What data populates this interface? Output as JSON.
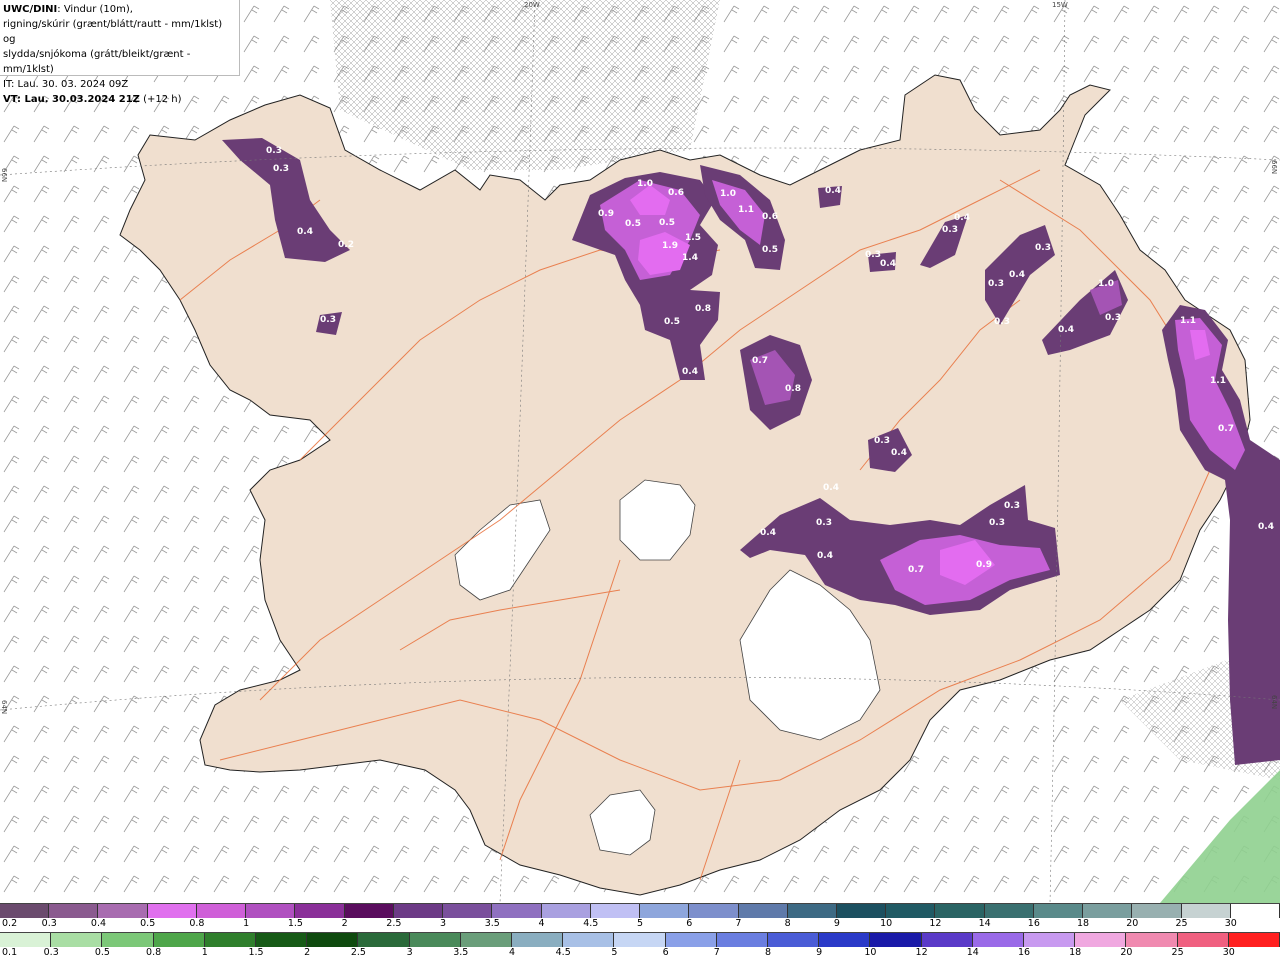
{
  "header": {
    "model": "UWC/DINI",
    "desc_line1": ": Vindur (10m),",
    "desc_line2": "rigning/skúrir (grænt/blátt/rautt - mm/1klst) og",
    "desc_line3": "slydda/snjókoma (grátt/bleikt/grænt - mm/1klst)",
    "it_line": "IT: Lau. 30. 03. 2024 09Z",
    "vt_label": "VT: Lau. 30.03.2024 21Z",
    "vt_suffix": " (+12 h)"
  },
  "grid_labels": [
    "20W",
    "15W",
    "66N",
    "66N",
    "64N",
    "64N"
  ],
  "map_values": [
    "0.3",
    "0.3",
    "0.4",
    "0.2",
    "0.3",
    "0.9",
    "1.0",
    "0.6",
    "0.5",
    "0.5",
    "1.9",
    "1.5",
    "1.4",
    "0.8",
    "0.5",
    "0.4",
    "1.0",
    "1.1",
    "0.6",
    "0.5",
    "0.4",
    "0.7",
    "0.8",
    "0.4",
    "0.3",
    "0.3",
    "0.4",
    "0.3",
    "0.4",
    "0.3",
    "0.3",
    "0.3",
    "1.0",
    "0.4",
    "0.3",
    "0.4",
    "0.4",
    "0.3",
    "0.4",
    "0.4",
    "0.7",
    "0.9",
    "0.3",
    "0.3",
    "1.1",
    "1.1",
    "0.7",
    "0.4"
  ],
  "colors": {
    "land": "#f0dfcf",
    "roads": "#e8703a",
    "sea": "#ffffff",
    "snow_light": "#9b5fa8",
    "snow_dark": "#6a3d75",
    "snow_bright": "#e36cf0",
    "rain_green": "#8fd08f"
  },
  "legend_top": {
    "labels": [
      "0.2",
      "0.3",
      "0.4",
      "0.5",
      "0.8",
      "1",
      "1.5",
      "2",
      "2.5",
      "3",
      "3.5",
      "4",
      "4.5",
      "5",
      "6",
      "7",
      "8",
      "9",
      "10",
      "12",
      "14",
      "16",
      "18",
      "20",
      "25",
      "30"
    ],
    "colors": [
      "#6b4b6e",
      "#8a5a8f",
      "#a86cb0",
      "#e070ee",
      "#cf5fd8",
      "#b050c0",
      "#8a2f99",
      "#5a0d5e",
      "#6c3a86",
      "#7a4f9c",
      "#8f70c0",
      "#a9a0e0",
      "#c0c0f4",
      "#8ea6dc",
      "#7d8fcc",
      "#5f7aaa",
      "#3d6a84",
      "#1c5060",
      "#205a64",
      "#2a6464",
      "#3a7070",
      "#5a8a8a",
      "#7a9e9e",
      "#98b0b0",
      "#c6d2d2",
      "#ffffff"
    ]
  },
  "legend_bottom": {
    "labels": [
      "0.1",
      "0.3",
      "0.5",
      "0.8",
      "1",
      "1.5",
      "2",
      "2.5",
      "3",
      "3.5",
      "4",
      "4.5",
      "5",
      "6",
      "7",
      "8",
      "9",
      "10",
      "12",
      "14",
      "16",
      "18",
      "20",
      "25",
      "30"
    ],
    "colors": [
      "#d9f2d6",
      "#a9deA4",
      "#7cc878",
      "#4ea64a",
      "#2f7f2c",
      "#165a16",
      "#0e4a0e",
      "#2a6a3a",
      "#4a8a5a",
      "#6a9e7a",
      "#8aaec0",
      "#a8c0e6",
      "#c6d6f4",
      "#8aa0e8",
      "#6a7ee0",
      "#4a5cd6",
      "#2a3ac8",
      "#1a1aa8",
      "#5a3ac8",
      "#9a6ae8",
      "#c89af0",
      "#f0a8e0",
      "#f08ab0",
      "#f06080",
      "#ff2020"
    ]
  }
}
